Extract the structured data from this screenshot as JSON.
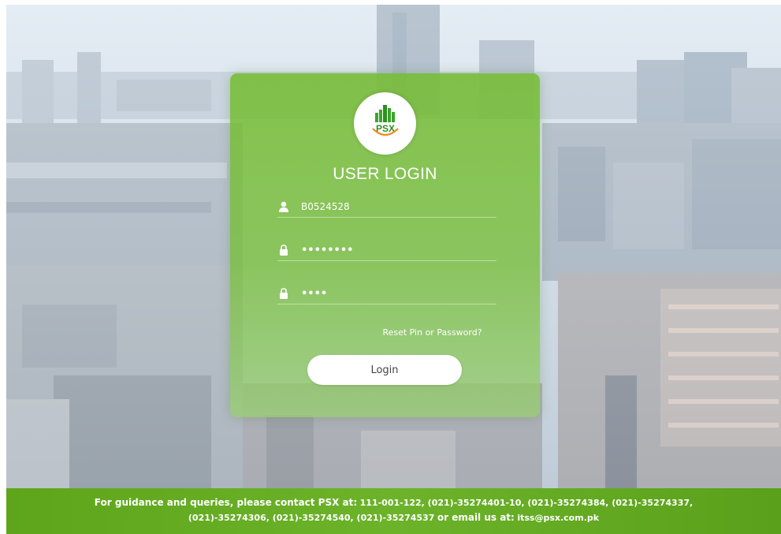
{
  "login": {
    "title": "USER LOGIN",
    "username_value": "B0524528",
    "password_value": "••••••••",
    "pin_value": "••••",
    "reset_link": "Reset Pin or Password?",
    "login_button": "Login"
  },
  "logo": {
    "text": "PSX",
    "icon": "psx-logo"
  },
  "footer": {
    "lead": "For guidance and queries, please contact PSX at:",
    "numbers_line1": "111-001-122, (021)-35274401-10, (021)-35274384, (021)-35274337,",
    "numbers_line2": "(021)-35274306, (021)-35274540, (021)-35274537",
    "email_lead": "or email us at:",
    "email": "itss@psx.com.pk"
  },
  "colors": {
    "card_green": "#74bc30",
    "footer_green": "#6cb32a",
    "logo_green": "#3aa52a",
    "logo_orange": "#f08a1c"
  },
  "icons": {
    "username": "user-icon",
    "password": "lock-icon",
    "pin": "lock-icon"
  }
}
